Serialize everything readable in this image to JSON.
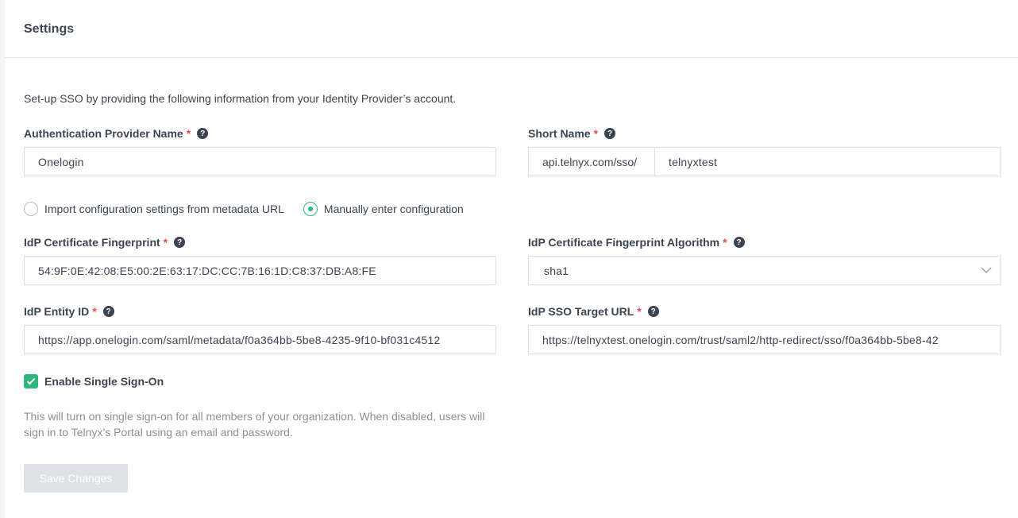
{
  "header": {
    "title": "Settings"
  },
  "intro": "Set-up SSO by providing the following information from your Identity Provider’s account.",
  "auth_provider": {
    "label": "Authentication Provider Name",
    "required": "*",
    "value": "Onelogin"
  },
  "short_name": {
    "label": "Short Name",
    "required": "*",
    "prefix": "api.telnyx.com/sso/",
    "value": "telnyxtest"
  },
  "config_mode": {
    "options": [
      {
        "label": "Import configuration settings from metadata URL",
        "selected": false
      },
      {
        "label": "Manually enter configuration",
        "selected": true
      }
    ]
  },
  "fingerprint": {
    "label": "IdP Certificate Fingerprint",
    "required": "*",
    "value": "54:9F:0E:42:08:E5:00:2E:63:17:DC:CC:7B:16:1D:C8:37:DB:A8:FE"
  },
  "fingerprint_algorithm": {
    "label": "IdP Certificate Fingerprint Algorithm",
    "required": "*",
    "value": "sha1"
  },
  "entity_id": {
    "label": "IdP Entity ID",
    "required": "*",
    "value": "https://app.onelogin.com/saml/metadata/f0a364bb-5be8-4235-9f10-bf031c4512"
  },
  "sso_target_url": {
    "label": "IdP SSO Target URL",
    "required": "*",
    "value": "https://telnyxtest.onelogin.com/trust/saml2/http-redirect/sso/f0a364bb-5be8-42"
  },
  "enable_sso": {
    "label": "Enable Single Sign-On",
    "checked": true
  },
  "description": "This will turn on single sign-on for all members of your organization. When disabled, users will sign in to Telnyx’s Portal using an email and password.",
  "save_button": {
    "label": "Save Changes"
  },
  "icons": {
    "help": "question-circle-icon",
    "chevron": "chevron-down-icon",
    "check": "check-icon"
  },
  "colors": {
    "accent": "#2fb67c",
    "required": "#e04b4b",
    "disabled_button": "#dee1e6"
  }
}
